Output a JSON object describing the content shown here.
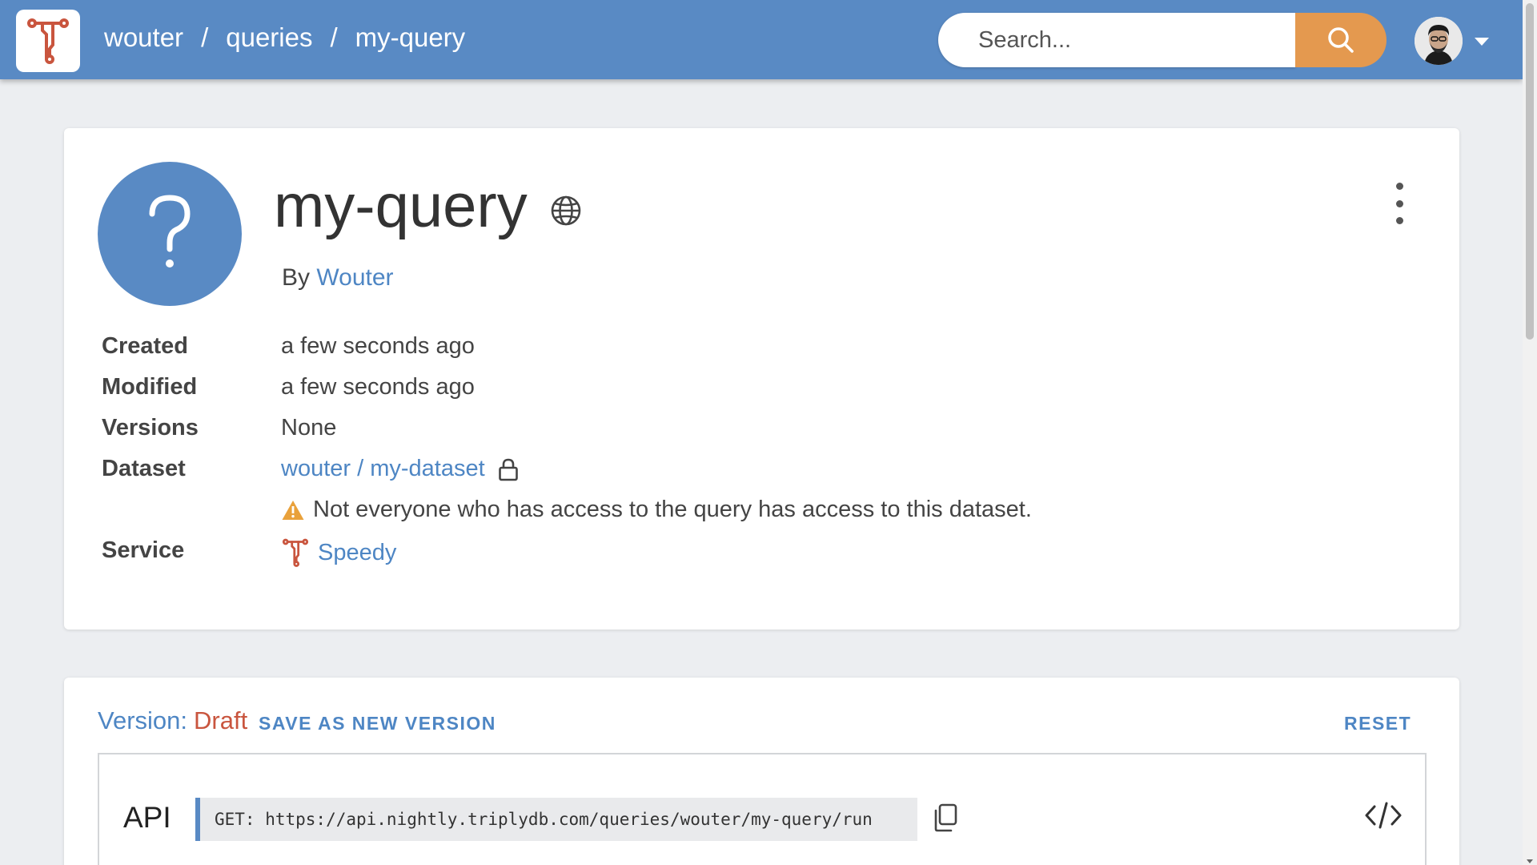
{
  "header": {
    "logo_icon": "triply-logo-icon",
    "breadcrumb": [
      "wouter",
      "queries",
      "my-query"
    ],
    "breadcrumb_separator": "/",
    "search": {
      "placeholder": "Search...",
      "value": ""
    },
    "colors": {
      "bar": "#598ac4",
      "search_button": "#e4994f"
    }
  },
  "query": {
    "title": "my-query",
    "visibility_icon": "globe-icon",
    "by_prefix": "By",
    "author": "Wouter",
    "avatar_icon": "question-mark-icon",
    "meta": {
      "created_label": "Created",
      "created_value": "a few seconds ago",
      "modified_label": "Modified",
      "modified_value": "a few seconds ago",
      "versions_label": "Versions",
      "versions_value": "None",
      "dataset_label": "Dataset",
      "dataset_value": "wouter / my-dataset",
      "dataset_icon": "lock-icon",
      "warning_icon": "warning-triangle-icon",
      "dataset_warning": "Not everyone who has access to the query has access to this dataset.",
      "service_label": "Service",
      "service_value": "Speedy",
      "service_icon": "triply-service-icon"
    }
  },
  "version": {
    "label": "Version:",
    "value": "Draft",
    "save_button": "SAVE AS NEW VERSION",
    "reset_button": "RESET",
    "api_label": "API",
    "api_url": "GET: https://api.nightly.triplydb.com/queries/wouter/my-query/run"
  }
}
